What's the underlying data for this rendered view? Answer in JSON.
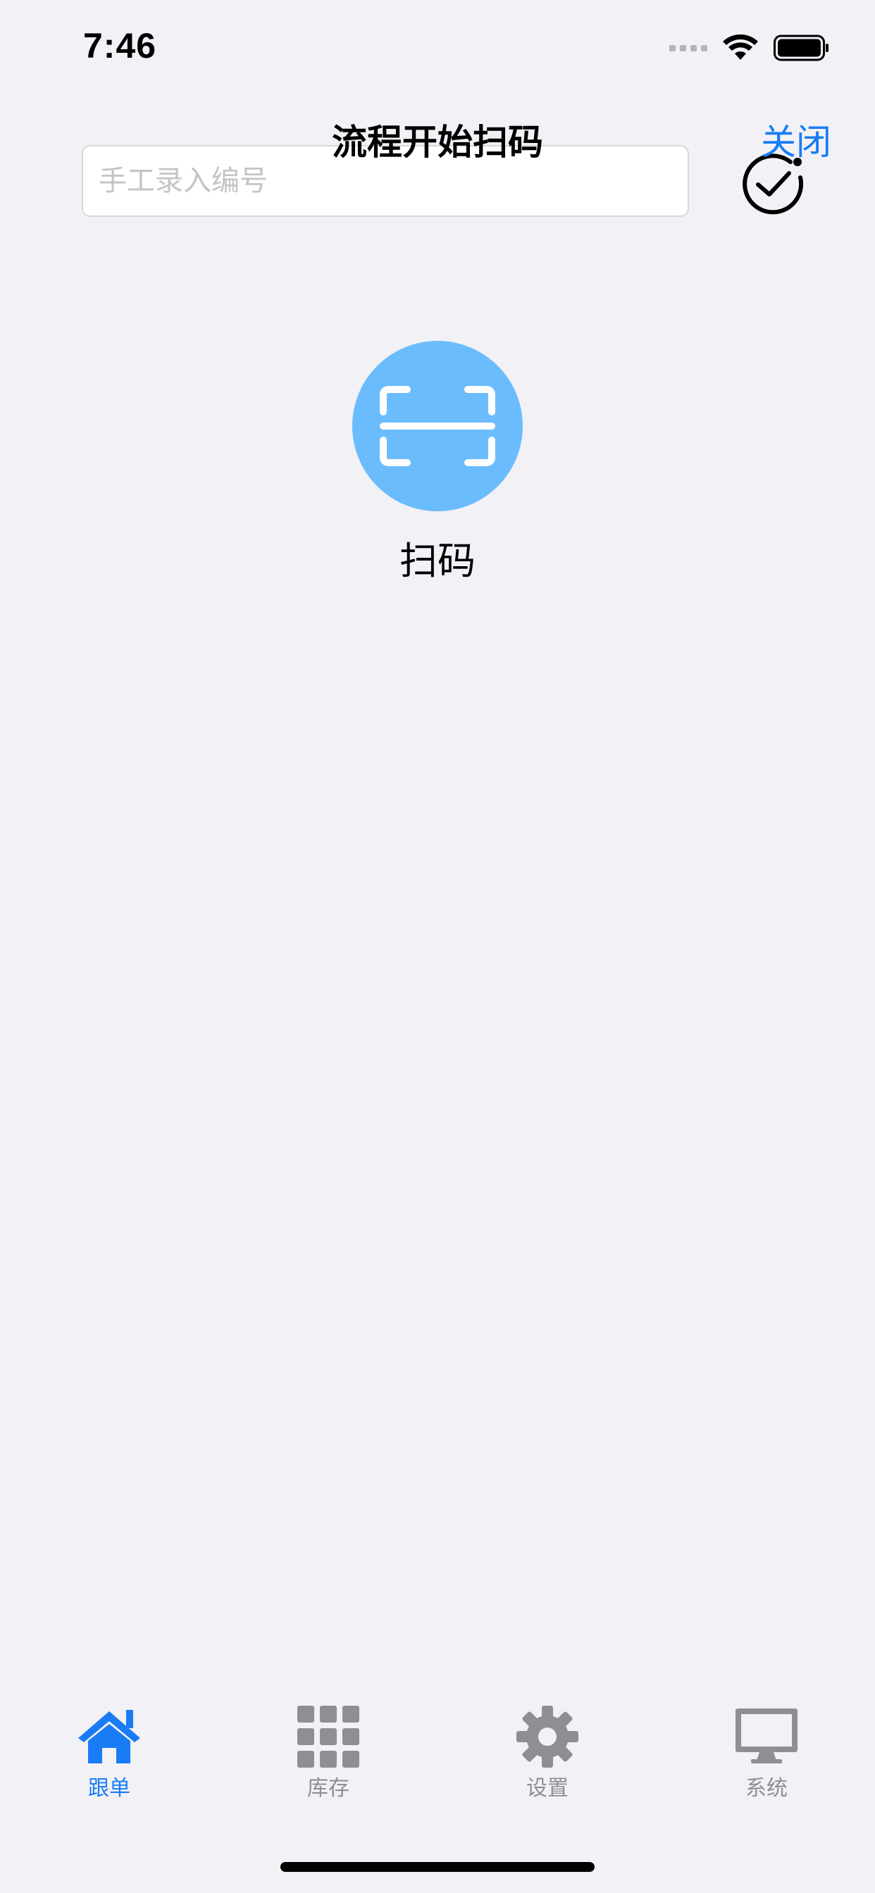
{
  "status_bar": {
    "time": "7:46"
  },
  "header": {
    "title": "流程开始扫码",
    "close_label": "关闭"
  },
  "manual_entry": {
    "placeholder": "手工录入编号",
    "value": ""
  },
  "scan": {
    "label": "扫码",
    "icon": "scan-frame-icon"
  },
  "tabs": [
    {
      "label": "跟单",
      "icon": "home-icon",
      "active": true
    },
    {
      "label": "库存",
      "icon": "grid-icon",
      "active": false
    },
    {
      "label": "设置",
      "icon": "gear-icon",
      "active": false
    },
    {
      "label": "系统",
      "icon": "monitor-icon",
      "active": false
    }
  ],
  "colors": {
    "background": "#f2f1f6",
    "accent": "#1a7cf5",
    "scan_circle": "#6bbcfc",
    "tab_inactive": "#8e8e93"
  }
}
